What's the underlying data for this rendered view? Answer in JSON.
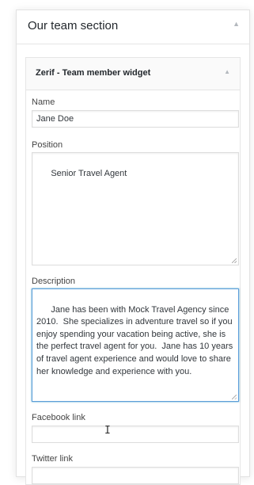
{
  "section": {
    "title": "Our team section",
    "toggle_icon": "triangle-up-icon"
  },
  "widget": {
    "title": "Zerif - Team member widget",
    "toggle_icon": "triangle-up-icon",
    "fields": {
      "name": {
        "label": "Name",
        "value": "Jane Doe"
      },
      "position": {
        "label": "Position",
        "value": "Senior Travel Agent"
      },
      "description": {
        "label": "Description",
        "value": "Jane has been with Mock Travel Agency since 2010.  She specializes in adventure travel so if you enjoy spending your vacation being active, she is the perfect travel agent for you.  Jane has 10 years of travel agent experience and would love to share her knowledge and experience with you."
      },
      "facebook": {
        "label": "Facebook link",
        "value": ""
      },
      "twitter": {
        "label": "Twitter link",
        "value": ""
      }
    }
  },
  "colors": {
    "focus_border": "#5b9dd9",
    "panel_border": "#e5e5e5"
  }
}
